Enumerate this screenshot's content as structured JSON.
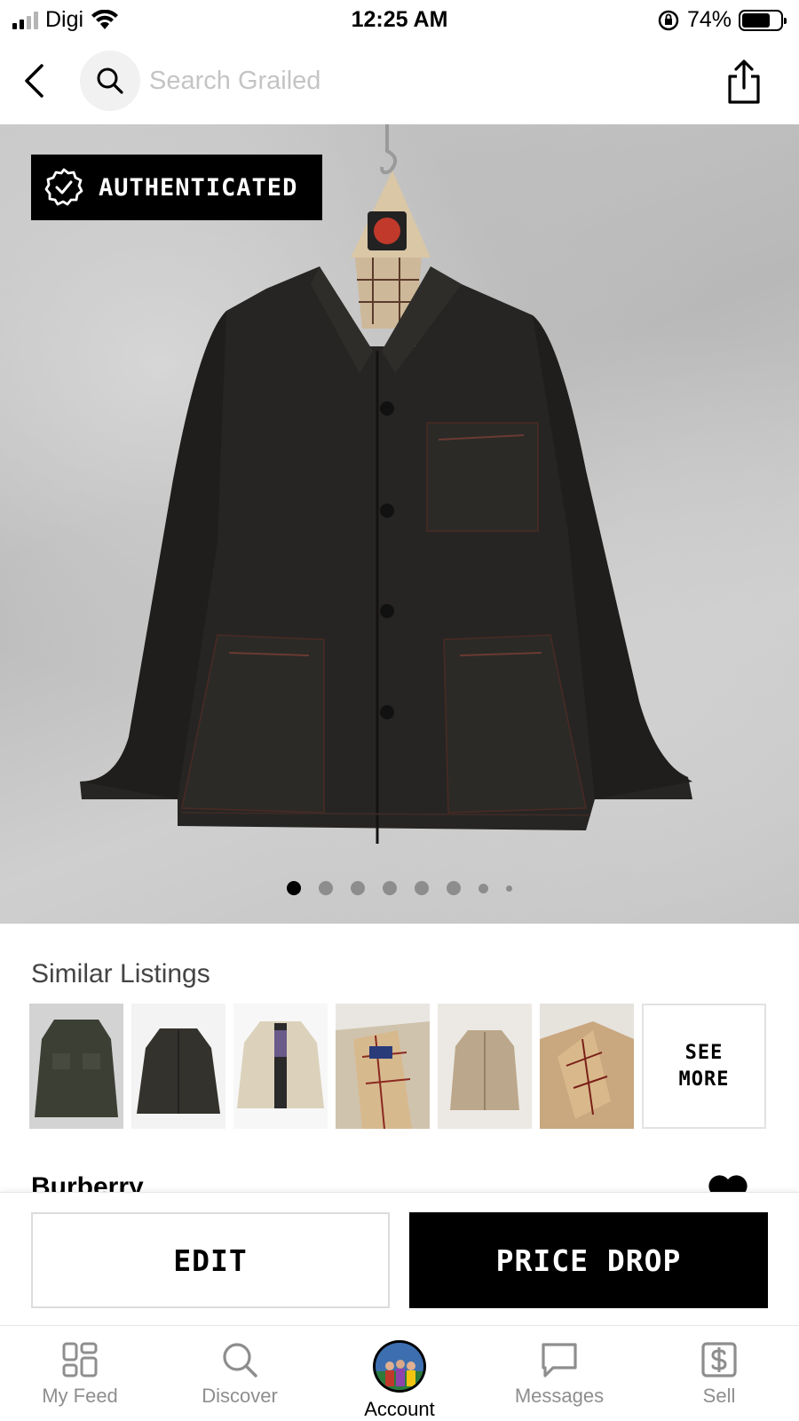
{
  "status_bar": {
    "carrier": "Digi",
    "time": "12:25 AM",
    "battery_percent": "74%",
    "battery_level": 0.74
  },
  "header": {
    "search_placeholder": "Search Grailed",
    "icons": [
      "chevron-left-icon",
      "search-icon",
      "share-icon"
    ]
  },
  "hero": {
    "badge_label": "AUTHENTICATED",
    "image_count": 8,
    "active_index": 0
  },
  "similar": {
    "title": "Similar Listings",
    "see_more_line1": "SEE",
    "see_more_line2": "MORE"
  },
  "listing": {
    "brand": "Burberry"
  },
  "actions": {
    "edit_label": "EDIT",
    "price_drop_label": "PRICE DROP"
  },
  "tabs": [
    {
      "label": "My Feed",
      "icon": "grid-icon"
    },
    {
      "label": "Discover",
      "icon": "search-icon"
    },
    {
      "label": "Account",
      "icon": "avatar"
    },
    {
      "label": "Messages",
      "icon": "message-icon"
    },
    {
      "label": "Sell",
      "icon": "dollar-tag-icon"
    }
  ],
  "colors": {
    "badge_bg": "#000000",
    "primary_button": "#000000",
    "inactive_tab": "#8e8e8e"
  }
}
